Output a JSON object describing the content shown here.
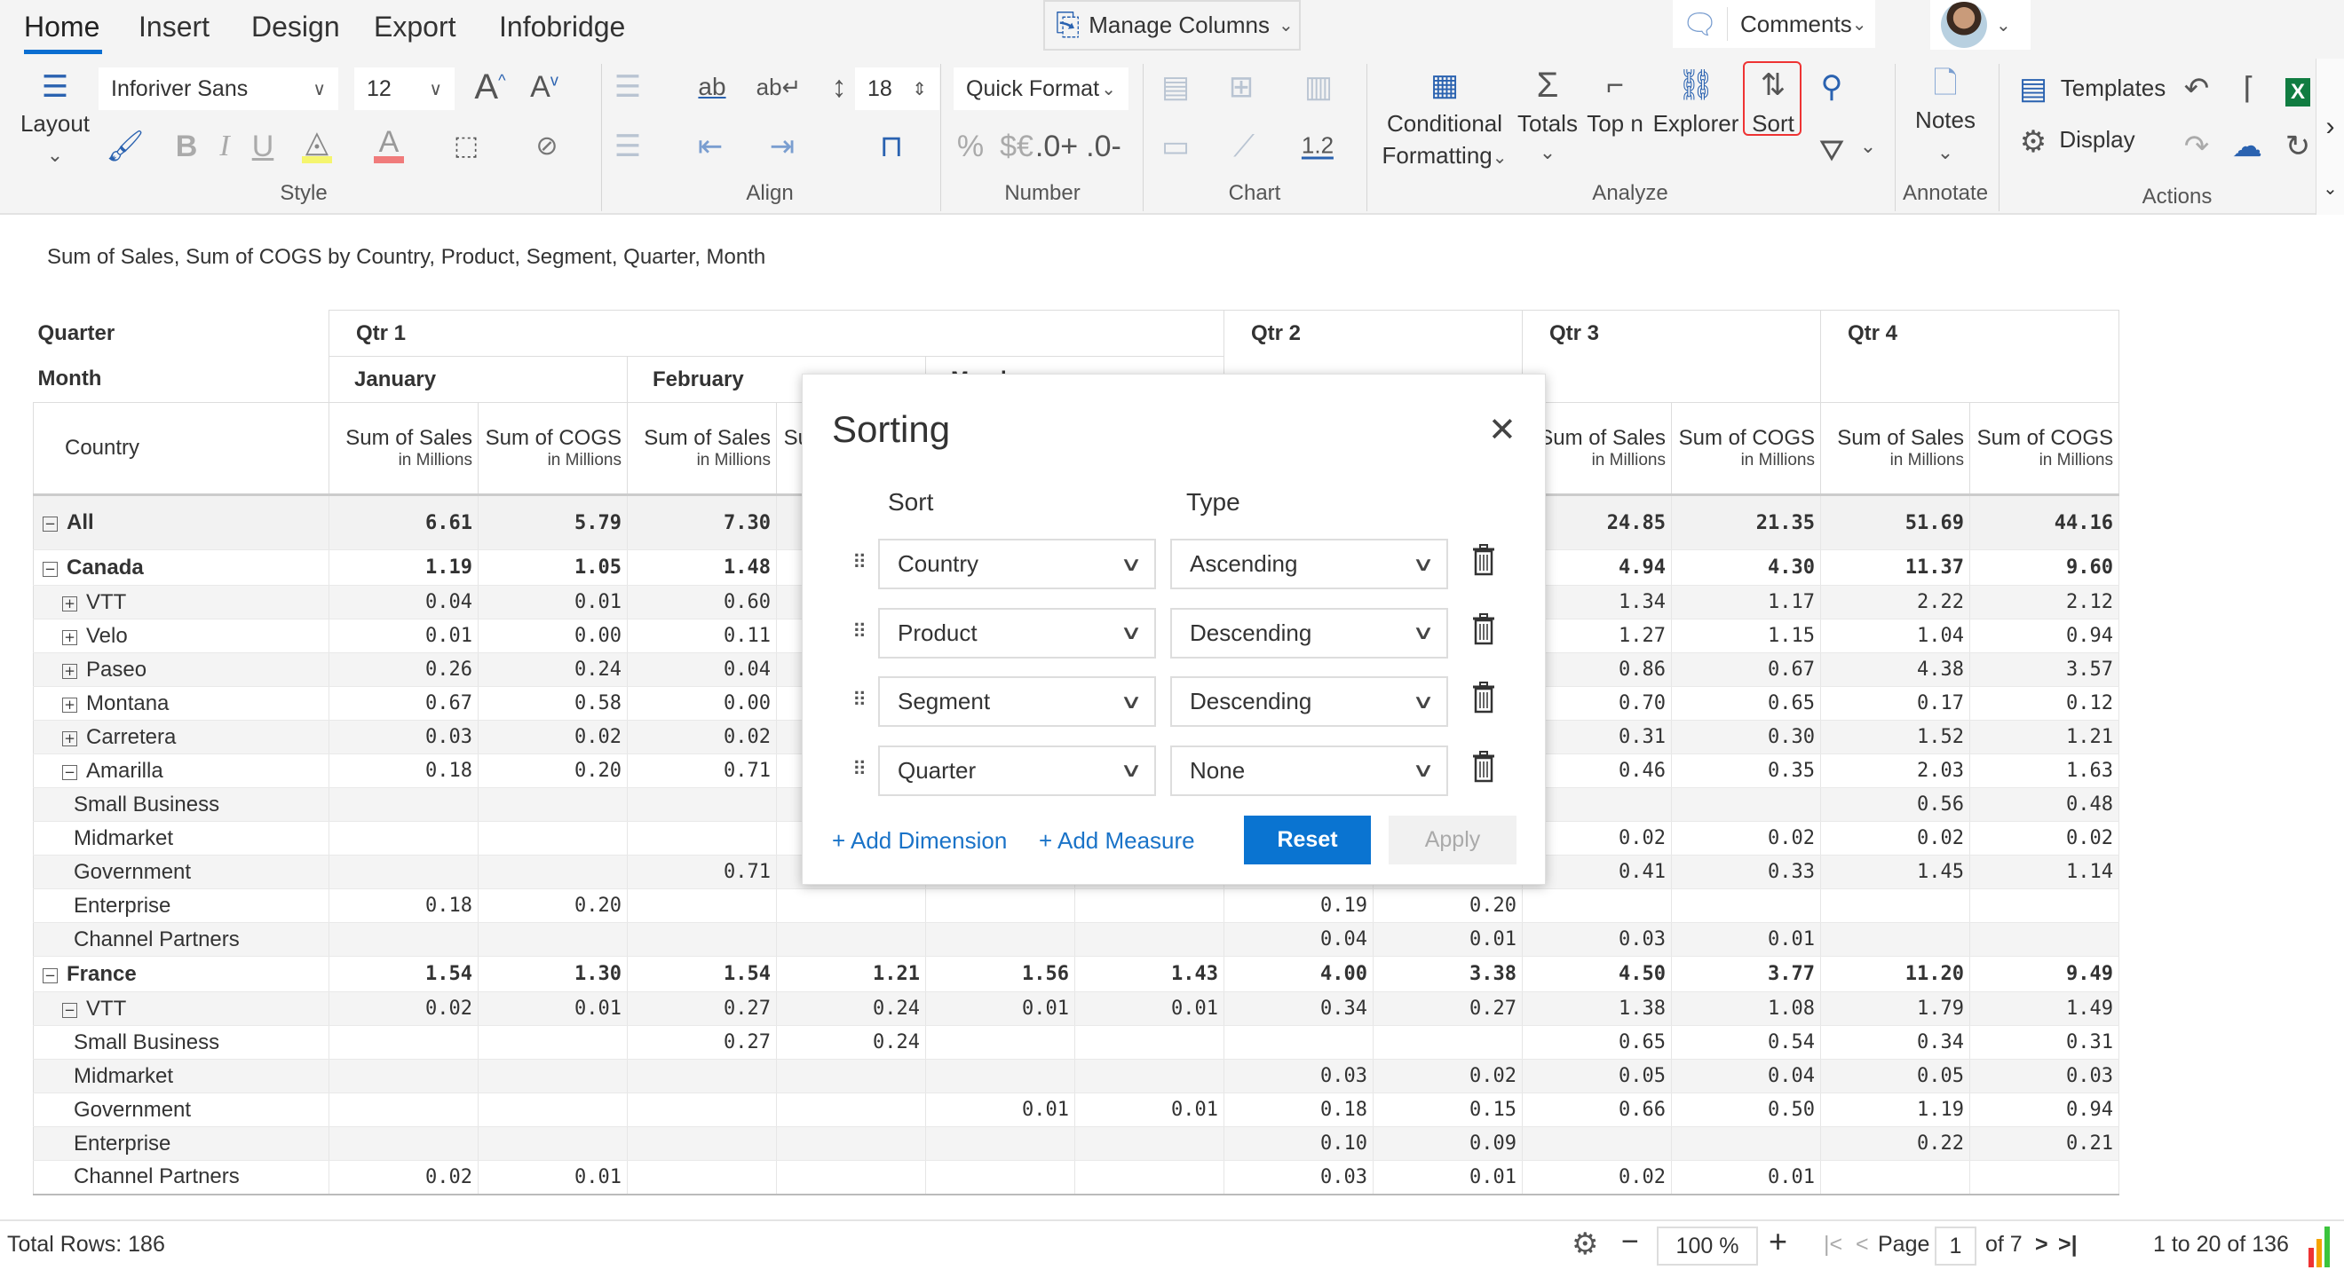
{
  "ribbon": {
    "tabs": [
      {
        "label": "Home",
        "active": true
      },
      {
        "label": "Insert"
      },
      {
        "label": "Design"
      },
      {
        "label": "Export"
      },
      {
        "label": "Infobridge"
      }
    ],
    "manage_columns": "Manage Columns",
    "comments": "Comments",
    "style": {
      "layout": "Layout",
      "font": "Inforiver Sans",
      "font_size": "12",
      "group": "Style",
      "highlight_color": "#f5f56e",
      "font_color": "#f07b7b"
    },
    "align": {
      "row_height": "18",
      "group": "Align"
    },
    "number": {
      "quick_format": "Quick Format",
      "decimal_sample": "1.2",
      "group": "Number",
      "percent": "%",
      "currency": "$€",
      "inc_decimal": ".0+",
      "dec_decimal": ".0-"
    },
    "chart": {
      "group": "Chart",
      "label_sample": "1.2"
    },
    "analyze": {
      "conditional": "Conditional",
      "formatting": "Formatting",
      "totals": "Totals",
      "topn": "Top n",
      "explorer": "Explorer",
      "sort": "Sort",
      "group": "Analyze"
    },
    "annotate": {
      "notes": "Notes",
      "group": "Annotate"
    },
    "actions": {
      "templates": "Templates",
      "display": "Display",
      "group": "Actions"
    }
  },
  "subtitle": "Sum of Sales, Sum of COGS by Country, Product, Segment, Quarter, Month",
  "table": {
    "quarter_label": "Quarter",
    "month_label": "Month",
    "row_header": "Country",
    "quarters": [
      "Qtr 1",
      "Qtr 2",
      "Qtr 3",
      "Qtr 4"
    ],
    "months": [
      "January",
      "February",
      "March"
    ],
    "measures": [
      "Sum of Sales",
      "Sum of COGS"
    ],
    "measure_unit": "in Millions",
    "rows": [
      {
        "label": "All",
        "level": 0,
        "type": "all",
        "expander": "minus",
        "values": [
          "6.61",
          "5.79",
          "7.30",
          null,
          null,
          null,
          null,
          null,
          "24.85",
          "21.35",
          "51.69",
          "44.16"
        ]
      },
      {
        "label": "Canada",
        "level": 0,
        "type": "country",
        "expander": "minus",
        "values": [
          "1.19",
          "1.05",
          "1.48",
          null,
          null,
          null,
          null,
          null,
          "4.94",
          "4.30",
          "11.37",
          "9.60"
        ]
      },
      {
        "label": "VTT",
        "level": 1,
        "expander": "plus",
        "values": [
          "0.04",
          "0.01",
          "0.60",
          null,
          null,
          null,
          null,
          null,
          "1.34",
          "1.17",
          "2.22",
          "2.12"
        ]
      },
      {
        "label": "Velo",
        "level": 1,
        "expander": "plus",
        "values": [
          "0.01",
          "0.00",
          "0.11",
          null,
          null,
          null,
          null,
          null,
          "1.27",
          "1.15",
          "1.04",
          "0.94"
        ]
      },
      {
        "label": "Paseo",
        "level": 1,
        "expander": "plus",
        "values": [
          "0.26",
          "0.24",
          "0.04",
          null,
          null,
          null,
          null,
          null,
          "0.86",
          "0.67",
          "4.38",
          "3.57"
        ]
      },
      {
        "label": "Montana",
        "level": 1,
        "expander": "plus",
        "values": [
          "0.67",
          "0.58",
          "0.00",
          null,
          null,
          null,
          null,
          null,
          "0.70",
          "0.65",
          "0.17",
          "0.12"
        ]
      },
      {
        "label": "Carretera",
        "level": 1,
        "expander": "plus",
        "values": [
          "0.03",
          "0.02",
          "0.02",
          null,
          null,
          null,
          null,
          null,
          "0.31",
          "0.30",
          "1.52",
          "1.21"
        ]
      },
      {
        "label": "Amarilla",
        "level": 1,
        "expander": "minus",
        "values": [
          "0.18",
          "0.20",
          "0.71",
          null,
          null,
          null,
          null,
          null,
          "0.46",
          "0.35",
          "2.03",
          "1.63"
        ]
      },
      {
        "label": "Small Business",
        "level": 2,
        "values": [
          "",
          "",
          "",
          null,
          null,
          null,
          null,
          null,
          "",
          "",
          "0.56",
          "0.48"
        ]
      },
      {
        "label": "Midmarket",
        "level": 2,
        "values": [
          "",
          "",
          "",
          null,
          null,
          null,
          null,
          null,
          "0.02",
          "0.02",
          "0.02",
          "0.02"
        ]
      },
      {
        "label": "Government",
        "level": 2,
        "values": [
          "",
          "",
          "0.71",
          null,
          null,
          null,
          null,
          null,
          "0.41",
          "0.33",
          "1.45",
          "1.14"
        ]
      },
      {
        "label": "Enterprise",
        "level": 2,
        "values": [
          "0.18",
          "0.20",
          "",
          "",
          "",
          "",
          "0.19",
          "0.20",
          "",
          "",
          "",
          ""
        ]
      },
      {
        "label": "Channel Partners",
        "level": 2,
        "values": [
          "",
          "",
          "",
          "",
          "",
          "",
          "0.04",
          "0.01",
          "0.03",
          "0.01",
          "",
          ""
        ]
      },
      {
        "label": "France",
        "level": 0,
        "type": "country",
        "expander": "minus",
        "values": [
          "1.54",
          "1.30",
          "1.54",
          "1.21",
          "1.56",
          "1.43",
          "4.00",
          "3.38",
          "4.50",
          "3.77",
          "11.20",
          "9.49"
        ]
      },
      {
        "label": "VTT",
        "level": 1,
        "expander": "minus",
        "values": [
          "0.02",
          "0.01",
          "0.27",
          "0.24",
          "0.01",
          "0.01",
          "0.34",
          "0.27",
          "1.38",
          "1.08",
          "1.79",
          "1.49"
        ]
      },
      {
        "label": "Small Business",
        "level": 2,
        "values": [
          "",
          "",
          "0.27",
          "0.24",
          "",
          "",
          "",
          "",
          "0.65",
          "0.54",
          "0.34",
          "0.31"
        ]
      },
      {
        "label": "Midmarket",
        "level": 2,
        "values": [
          "",
          "",
          "",
          "",
          "",
          "",
          "0.03",
          "0.02",
          "0.05",
          "0.04",
          "0.05",
          "0.03"
        ]
      },
      {
        "label": "Government",
        "level": 2,
        "values": [
          "",
          "",
          "",
          "",
          "0.01",
          "0.01",
          "0.18",
          "0.15",
          "0.66",
          "0.50",
          "1.19",
          "0.94"
        ]
      },
      {
        "label": "Enterprise",
        "level": 2,
        "values": [
          "",
          "",
          "",
          "",
          "",
          "",
          "0.10",
          "0.09",
          "",
          "",
          "0.22",
          "0.21"
        ]
      },
      {
        "label": "Channel Partners",
        "level": 2,
        "values": [
          "0.02",
          "0.01",
          "",
          "",
          "",
          "",
          "0.03",
          "0.01",
          "0.02",
          "0.01",
          "",
          ""
        ]
      }
    ]
  },
  "sorting_dialog": {
    "title": "Sorting",
    "sort_header": "Sort",
    "type_header": "Type",
    "rules": [
      {
        "field": "Country",
        "type": "Ascending"
      },
      {
        "field": "Product",
        "type": "Descending"
      },
      {
        "field": "Segment",
        "type": "Descending"
      },
      {
        "field": "Quarter",
        "type": "None"
      }
    ],
    "add_dimension": "+ Add Dimension",
    "add_measure": "+ Add Measure",
    "reset": "Reset",
    "apply": "Apply",
    "accent": "#0a74d1"
  },
  "footer": {
    "total_rows": "Total Rows: 186",
    "zoom": "100 %",
    "page_label": "Page",
    "page": "1",
    "of_pages": "of 7",
    "range": "1 to 20 of 136"
  }
}
